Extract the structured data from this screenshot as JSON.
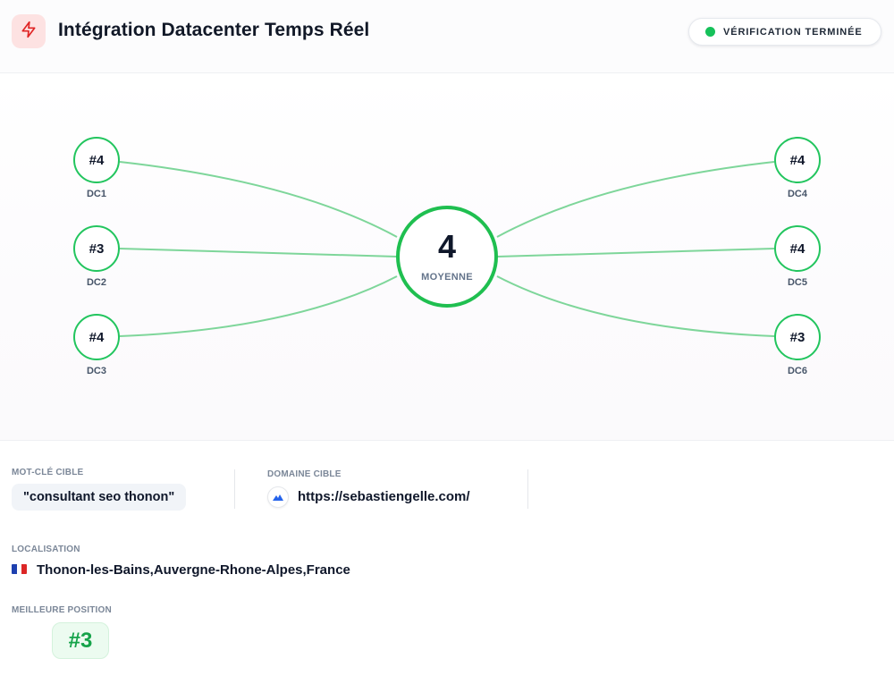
{
  "header": {
    "title": "Intégration Datacenter Temps Réel",
    "logo_icon": "bolt-icon",
    "status": {
      "label": "VÉRIFICATION TERMINÉE",
      "color": "#16c15a"
    }
  },
  "diagram": {
    "hub": {
      "value": "4",
      "label": "MOYENNE"
    },
    "line_color": "#22c55e",
    "datacenters": [
      {
        "name": "DC1",
        "rank": "#4",
        "side": "left"
      },
      {
        "name": "DC2",
        "rank": "#3",
        "side": "left"
      },
      {
        "name": "DC3",
        "rank": "#4",
        "side": "left"
      },
      {
        "name": "DC4",
        "rank": "#4",
        "side": "right"
      },
      {
        "name": "DC5",
        "rank": "#4",
        "side": "right"
      },
      {
        "name": "DC6",
        "rank": "#3",
        "side": "right"
      }
    ]
  },
  "info": {
    "keyword": {
      "label": "MOT-CLÉ CIBLE",
      "value": "\"consultant seo thonon\""
    },
    "domain": {
      "label": "DOMAINE CIBLE",
      "value": "https://sebastiengelle.com/",
      "icon": "site-logo-icon"
    },
    "location": {
      "label": "LOCALISATION",
      "value": "Thonon-les-Bains,Auvergne-Rhone-Alpes,France",
      "flag_icon": "france-flag-icon"
    },
    "best_position": {
      "label": "MEILLEURE POSITION",
      "value": "#3"
    }
  }
}
